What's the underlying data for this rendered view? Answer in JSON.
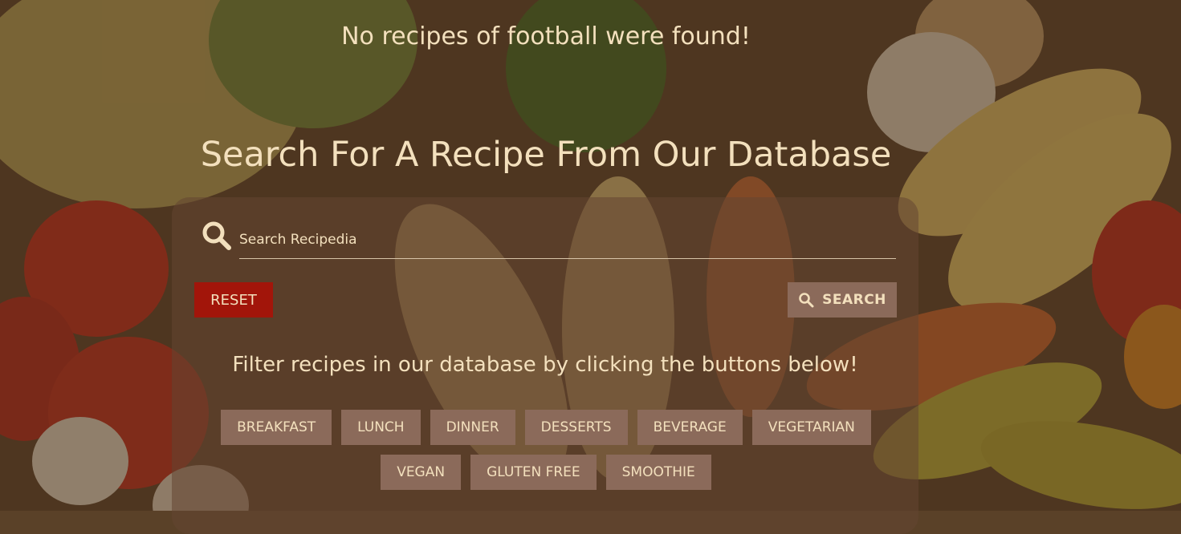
{
  "notice": "No recipes of football were found!",
  "title": "Search For A Recipe From Our Database",
  "search": {
    "placeholder": "Search Recipedia",
    "reset_label": "RESET",
    "search_label": "SEARCH"
  },
  "filters": {
    "intro": "Filter recipes in our database by clicking the buttons below!",
    "buttons": [
      "BREAKFAST",
      "LUNCH",
      "DINNER",
      "DESSERTS",
      "BEVERAGE",
      "VEGETARIAN",
      "VEGAN",
      "GLUTEN FREE",
      "SMOOTHIE"
    ]
  },
  "colors": {
    "text": "#f3e0bd",
    "reset": "#a2150a",
    "button": "#8b6a5a"
  }
}
